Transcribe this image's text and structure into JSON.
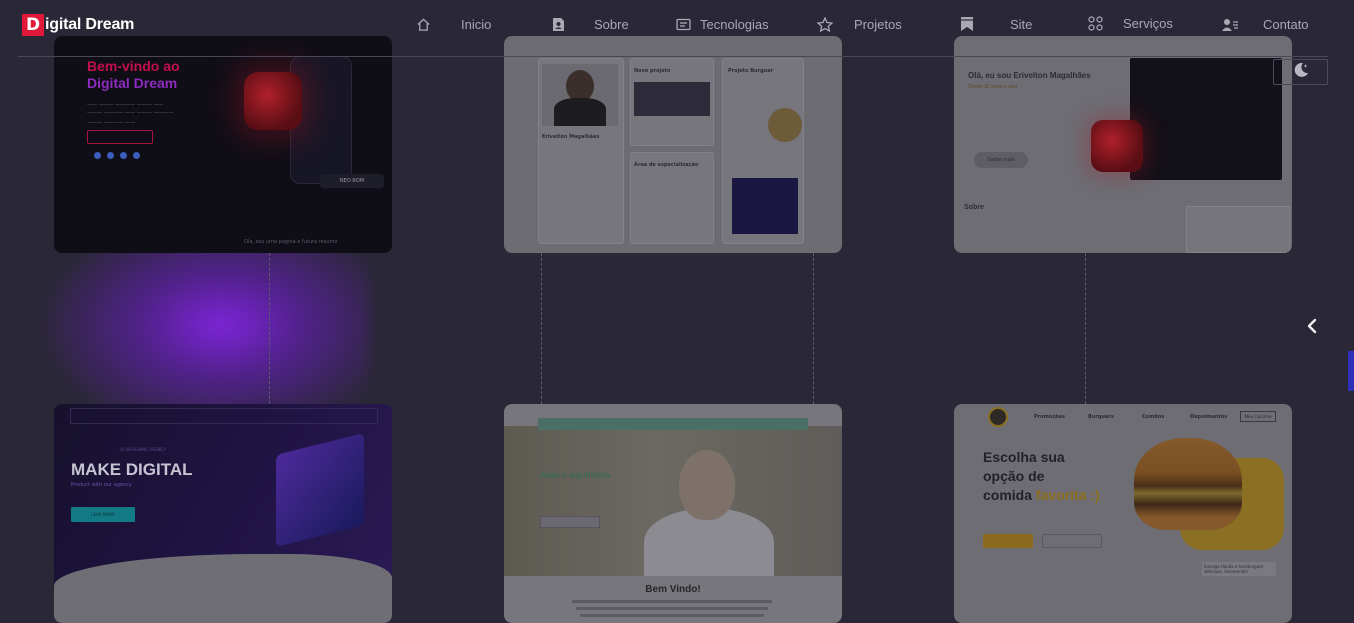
{
  "brand": {
    "badge": "D",
    "name": "igital Dream",
    "accent": "#e0183a"
  },
  "nav": {
    "items": [
      {
        "label": "Inicio",
        "icon": "home-icon"
      },
      {
        "label": "Sobre",
        "icon": "profile-document-icon"
      },
      {
        "label": "Tecnologias",
        "icon": "id-card-icon"
      },
      {
        "label": "Projetos",
        "icon": "star-icon"
      },
      {
        "label": "Site",
        "icon": "bookmark-icon"
      },
      {
        "label": "Serviços",
        "icon": "grid-icon"
      },
      {
        "label": "Contato",
        "icon": "contacts-icon"
      }
    ]
  },
  "controls": {
    "theme_icon": "moon-icon",
    "carousel_icon": "chevron-left-icon"
  },
  "projects": [
    {
      "name": "digital-dream-portfolio",
      "heading_1": "Bem-vindo ao",
      "heading_2": "Digital Dream",
      "tag": "NEO ROM",
      "footer": "Ola, sou uma pagina e futura resumo"
    },
    {
      "name": "erivelton-profile",
      "person": "Erivelton Magalhães",
      "section_1": "Novo projeto",
      "section_2": "Projeto Burguer",
      "section_3": "Área de especialização"
    },
    {
      "name": "erivelton-about",
      "heading": "Olá, eu sou Erivelton Magalhães",
      "sub": "Tenho 32 anos e sou",
      "button": "Saiba mais",
      "section": "Sobre"
    },
    {
      "name": "make-digital-agency",
      "kicker": "UI DESIGNING AGENCY",
      "title": "MAKE DIGITAL",
      "sub": "Product with our agency",
      "button": "LEAR MORE"
    },
    {
      "name": "clinic-landing",
      "hero": "Ame e equilíbrio.",
      "button": "Agendar consulta",
      "title": "Bem Vindo!"
    },
    {
      "name": "burger-shop",
      "title_1": "Escolha sua",
      "title_2": "opção de",
      "title_3": "comida ",
      "title_fav": "favorita :)",
      "menu": [
        "Promoções",
        "Burguers",
        "Combos",
        "Depoimentos"
      ],
      "cta": "Meu Carrinho",
      "quote": "Entrega rápida e hamburguer delicioso, recomendo!"
    }
  ]
}
